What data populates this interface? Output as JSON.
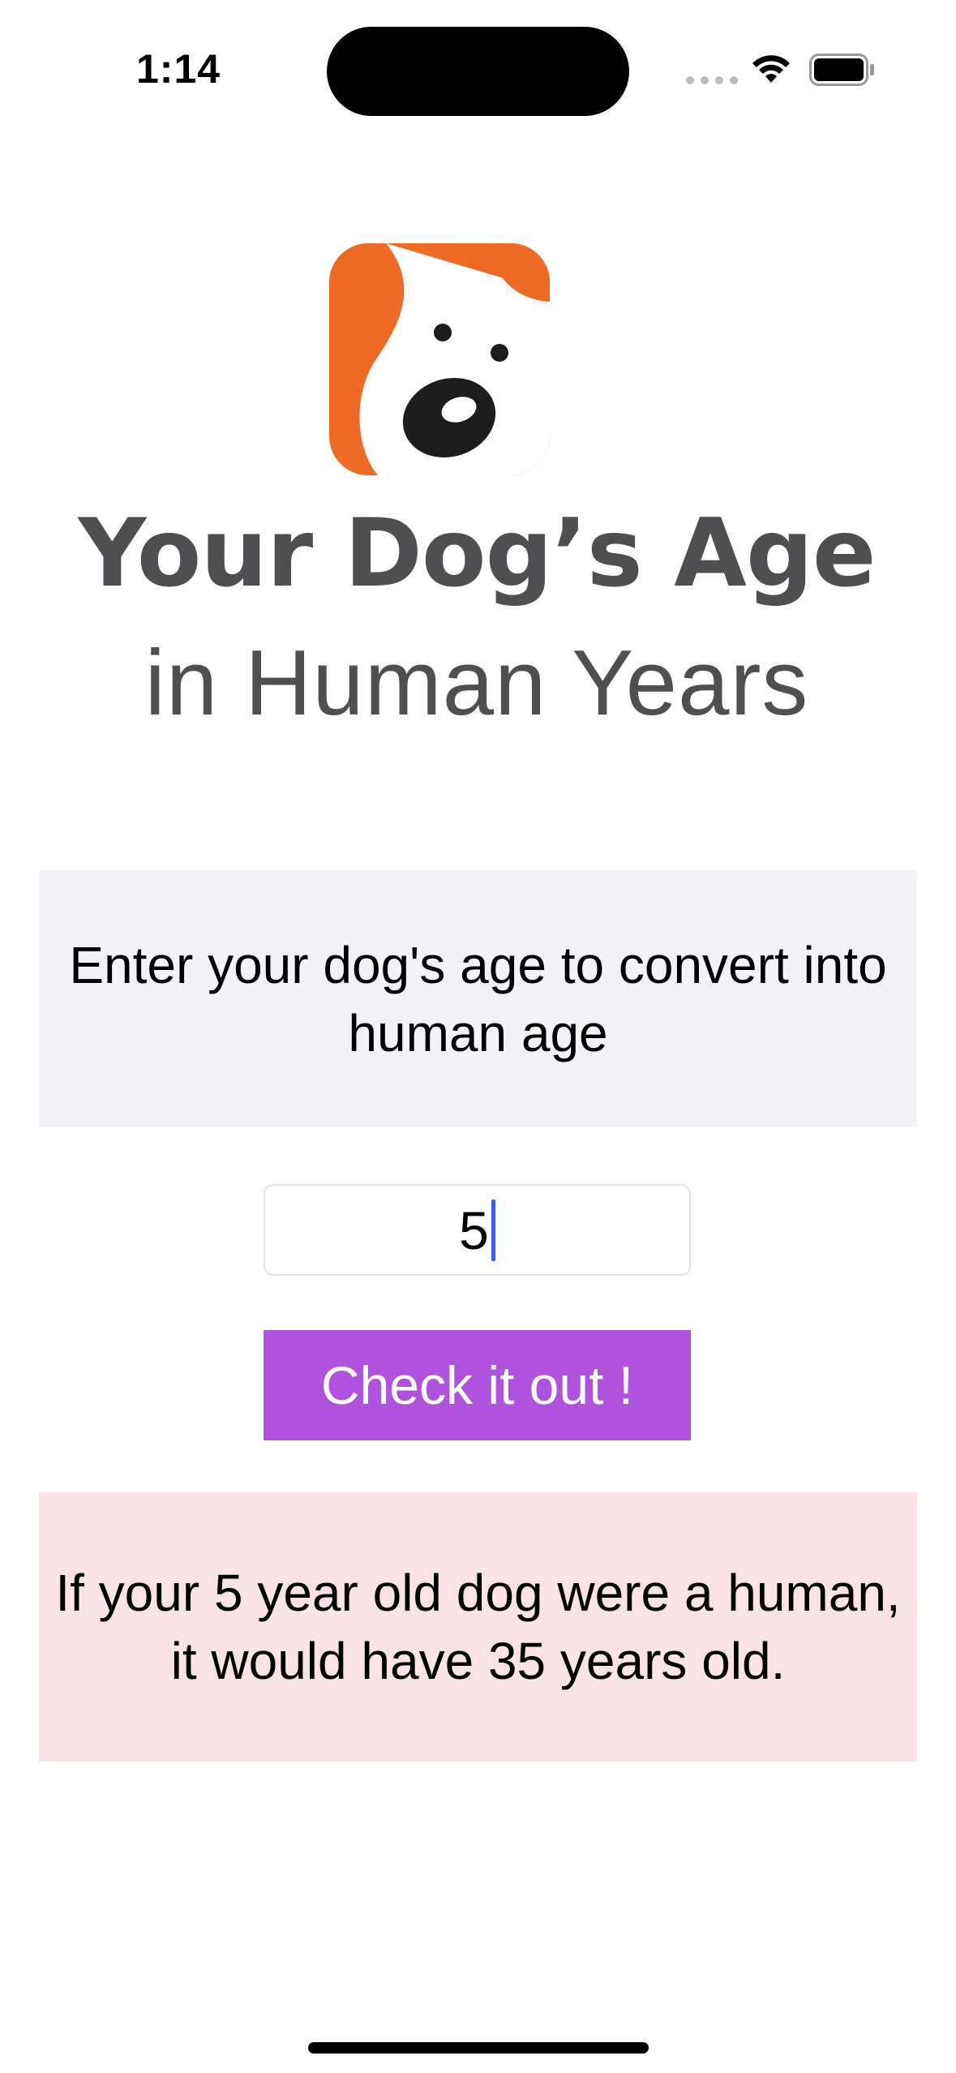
{
  "status_bar": {
    "time": "1:14"
  },
  "logo": {
    "line1": "Your Dog’s Age",
    "line2": "in Human Years",
    "colors": {
      "orange": "#ef6a25",
      "text": "#4f4f51"
    }
  },
  "prompt": {
    "text": "Enter your dog's age to convert into human age"
  },
  "age_input": {
    "value": "5"
  },
  "button": {
    "label": "Check it out !"
  },
  "result": {
    "text": "If your 5 year old dog were a human, it would have 35 years old."
  },
  "colors": {
    "prompt_background": "#f2f2f7",
    "button_background": "#af52de",
    "result_background": "#f9e3e6"
  },
  "icons": [
    "wifi-icon",
    "battery-icon",
    "dog-logo-icon"
  ]
}
